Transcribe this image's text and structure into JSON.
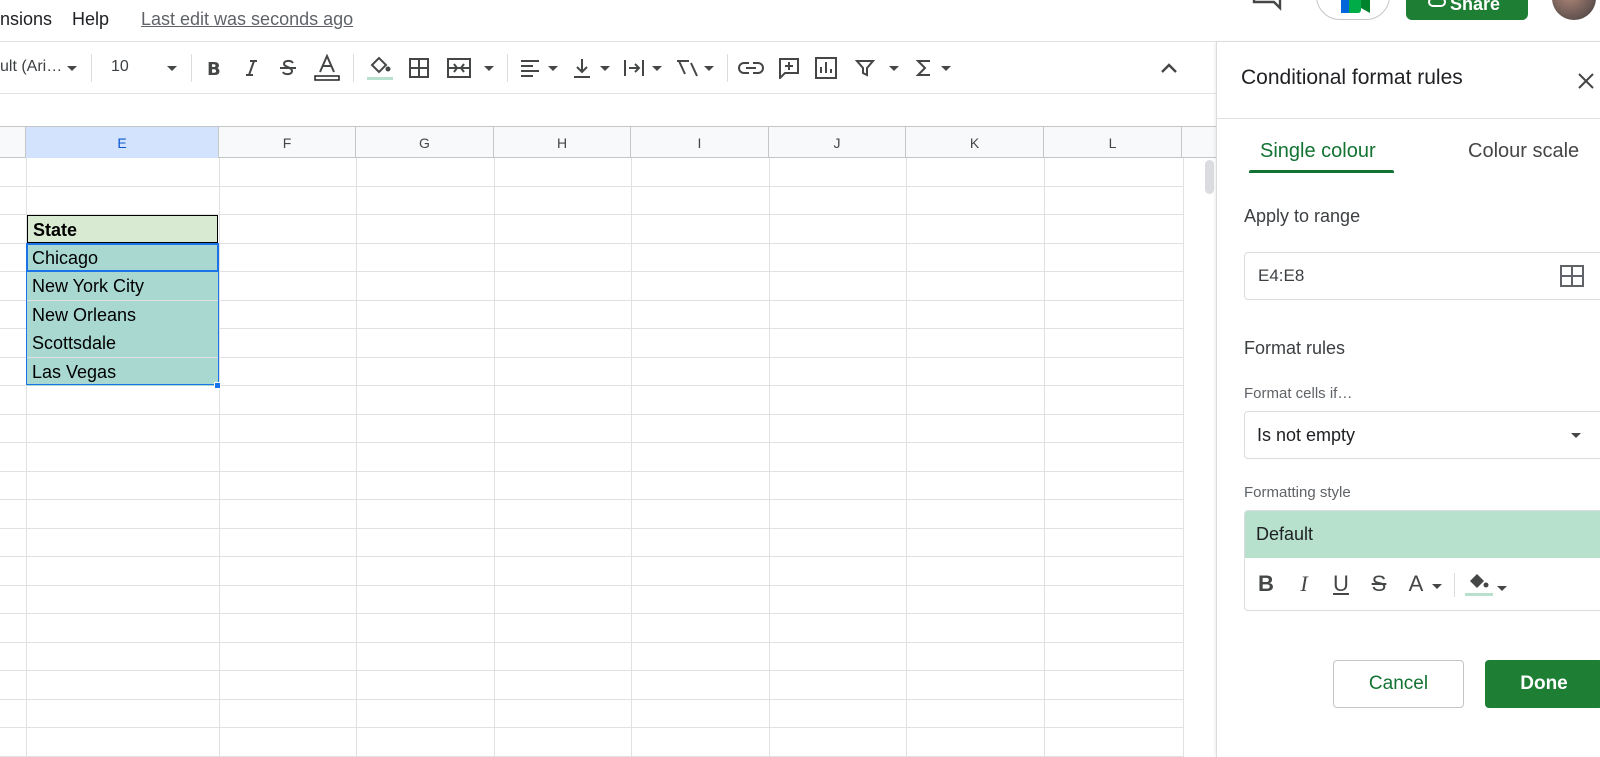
{
  "menubar": {
    "items": [
      "nsions",
      "Help"
    ],
    "last_edit": "Last edit was seconds ago",
    "share_label": "Share"
  },
  "toolbar": {
    "font_name": "ult (Ari…",
    "font_size": "10"
  },
  "sheet": {
    "columns": [
      "E",
      "F",
      "G",
      "H",
      "I",
      "J",
      "K",
      "L"
    ],
    "selected_column": "E",
    "cells": [
      "State",
      "Chicago",
      "New York City",
      "New Orleans",
      "Scottsdale",
      "Las Vegas"
    ]
  },
  "panel": {
    "title": "Conditional format rules",
    "tabs": [
      "Single colour",
      "Colour scale"
    ],
    "active_tab": "Single colour",
    "apply_to_range_label": "Apply to range",
    "range_value": "E4:E8",
    "format_rules_label": "Format rules",
    "format_cells_if_label": "Format cells if…",
    "condition_value": "Is not empty",
    "formatting_style_label": "Formatting style",
    "style_preview": "Default",
    "style_tools": {
      "bold": "B",
      "italic": "I",
      "underline": "U",
      "strike": "S",
      "text_color": "A"
    },
    "cancel_label": "Cancel",
    "done_label": "Done"
  },
  "colors": {
    "accent_green": "#137333",
    "button_green": "#1e7e34",
    "header_fill": "#d9ead3",
    "data_fill": "#a9d8d1",
    "preview_fill": "#b7e1cd",
    "selection_blue": "#1a73e8"
  }
}
